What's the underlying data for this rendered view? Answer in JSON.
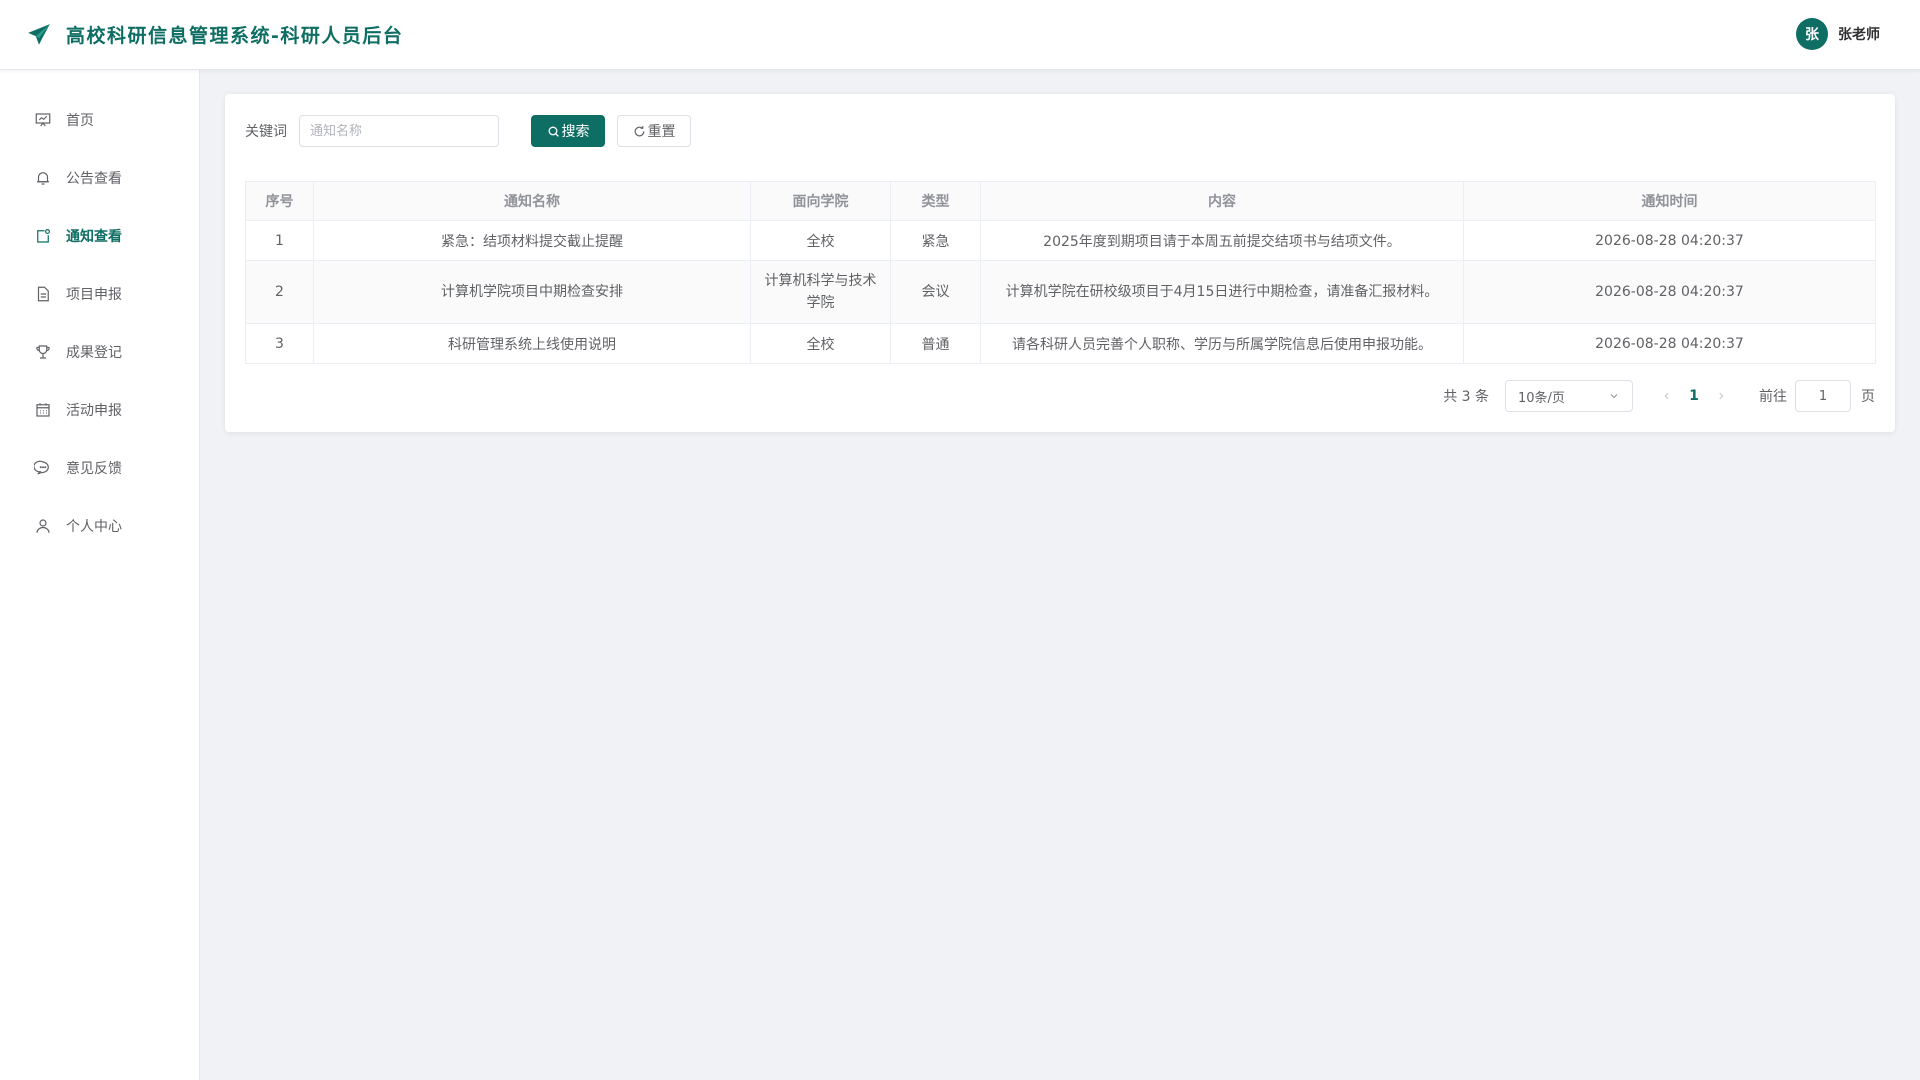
{
  "header": {
    "title": "高校科研信息管理系统-科研人员后台",
    "avatar_char": "张",
    "user_name": "张老师",
    "brand_color": "#0f6e63"
  },
  "sidebar": {
    "items": [
      {
        "label": "首页",
        "icon": "presentation-icon"
      },
      {
        "label": "公告查看",
        "icon": "bell-icon"
      },
      {
        "label": "通知查看",
        "icon": "message-notification-icon",
        "active": true
      },
      {
        "label": "项目申报",
        "icon": "document-icon"
      },
      {
        "label": "成果登记",
        "icon": "trophy-icon"
      },
      {
        "label": "活动申报",
        "icon": "calendar-icon"
      },
      {
        "label": "意见反馈",
        "icon": "chat-bubble-icon"
      },
      {
        "label": "个人中心",
        "icon": "user-icon"
      }
    ]
  },
  "search": {
    "label": "关键词",
    "placeholder": "通知名称",
    "value": "",
    "search_button": "搜索",
    "reset_button": "重置"
  },
  "table": {
    "columns": [
      "序号",
      "通知名称",
      "面向学院",
      "类型",
      "内容",
      "通知时间"
    ],
    "rows": [
      [
        "1",
        "紧急：结项材料提交截止提醒",
        "全校",
        "紧急",
        "2025年度到期项目请于本周五前提交结项书与结项文件。",
        "2026-08-28 04:20:37"
      ],
      [
        "2",
        "计算机学院项目中期检查安排",
        "计算机科学与技术学院",
        "会议",
        "计算机学院在研校级项目于4月15日进行中期检查，请准备汇报材料。",
        "2026-08-28 04:20:37"
      ],
      [
        "3",
        "科研管理系统上线使用说明",
        "全校",
        "普通",
        "请各科研人员完善个人职称、学历与所属学院信息后使用申报功能。",
        "2026-08-28 04:20:37"
      ]
    ]
  },
  "pagination": {
    "total_text": "共 3 条",
    "page_size": "10条/页",
    "current_page": "1",
    "goto_label": "前往",
    "goto_value": "1",
    "page_suffix": "页"
  }
}
